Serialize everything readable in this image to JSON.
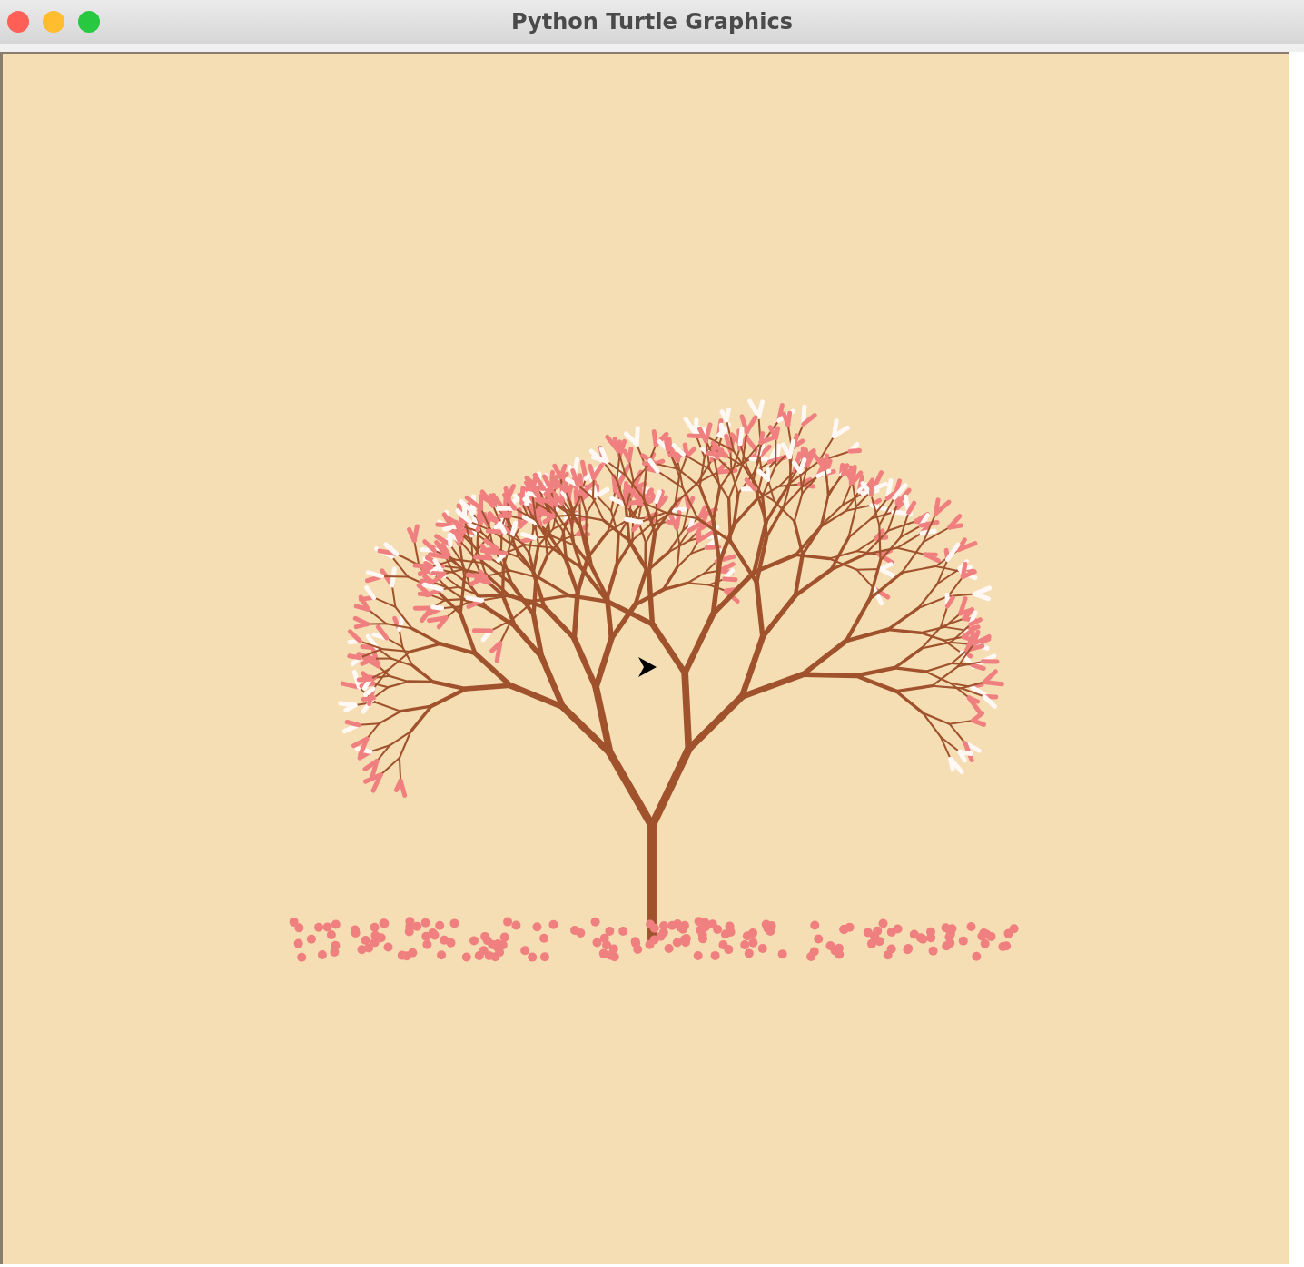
{
  "window": {
    "title": "Python Turtle Graphics"
  }
}
